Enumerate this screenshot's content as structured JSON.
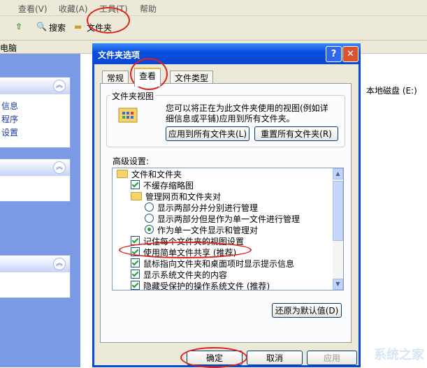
{
  "explorer": {
    "menu": [
      "查看(V)",
      "收藏(A)",
      "工具(T)",
      "帮助"
    ],
    "toolbar": {
      "search": "搜索",
      "folders": "文件夹"
    },
    "address": "电脑",
    "left_links": [
      "信息",
      "程序",
      "设置"
    ],
    "drive_label": "本地磁盘 (E:)"
  },
  "dialog": {
    "title": "文件夹选项",
    "help_glyph": "?",
    "close_glyph": "✕",
    "tabs": [
      "常规",
      "查看",
      "文件类型"
    ],
    "active_tab": "查看",
    "folder_view": {
      "title": "文件夹视图",
      "description": "您可以将正在为此文件夹使用的视图(例如详细信息或平铺)应用到所有文件夹。",
      "apply_all": "应用到所有文件夹(L)",
      "reset_all": "重置所有文件夹(R)"
    },
    "advanced": {
      "label": "高级设置:",
      "items": [
        {
          "type": "folder",
          "label": "文件和文件夹"
        },
        {
          "type": "checkbox",
          "label": "不缓存缩略图",
          "checked": true
        },
        {
          "type": "folder",
          "label": "管理网页和文件夹对"
        },
        {
          "type": "radio",
          "label": "显示两部分并分别进行管理",
          "checked": false
        },
        {
          "type": "radio",
          "label": "显示两部分但是作为单一文件进行管理",
          "checked": false
        },
        {
          "type": "radio",
          "label": "作为单一文件显示和管理对",
          "checked": true
        },
        {
          "type": "checkbox",
          "label": "记住每个文件夹的视图设置",
          "checked": true
        },
        {
          "type": "checkbox",
          "label": "使用简单文件共享 (推荐)",
          "checked": true
        },
        {
          "type": "checkbox",
          "label": "鼠标指向文件夹和桌面项时显示提示信息",
          "checked": true
        },
        {
          "type": "checkbox",
          "label": "显示系统文件夹的内容",
          "checked": true
        },
        {
          "type": "checkbox",
          "label": "隐藏受保护的操作系统文件 (推荐)",
          "checked": true
        }
      ]
    },
    "restore_defaults": "还原为默认值(D)",
    "ok": "确定",
    "cancel": "取消",
    "apply": "应用"
  },
  "watermark": "系统之家",
  "colors": {
    "annotation": "#e0201d",
    "xp_title": "#0a4fe0",
    "check": "#21a121"
  }
}
